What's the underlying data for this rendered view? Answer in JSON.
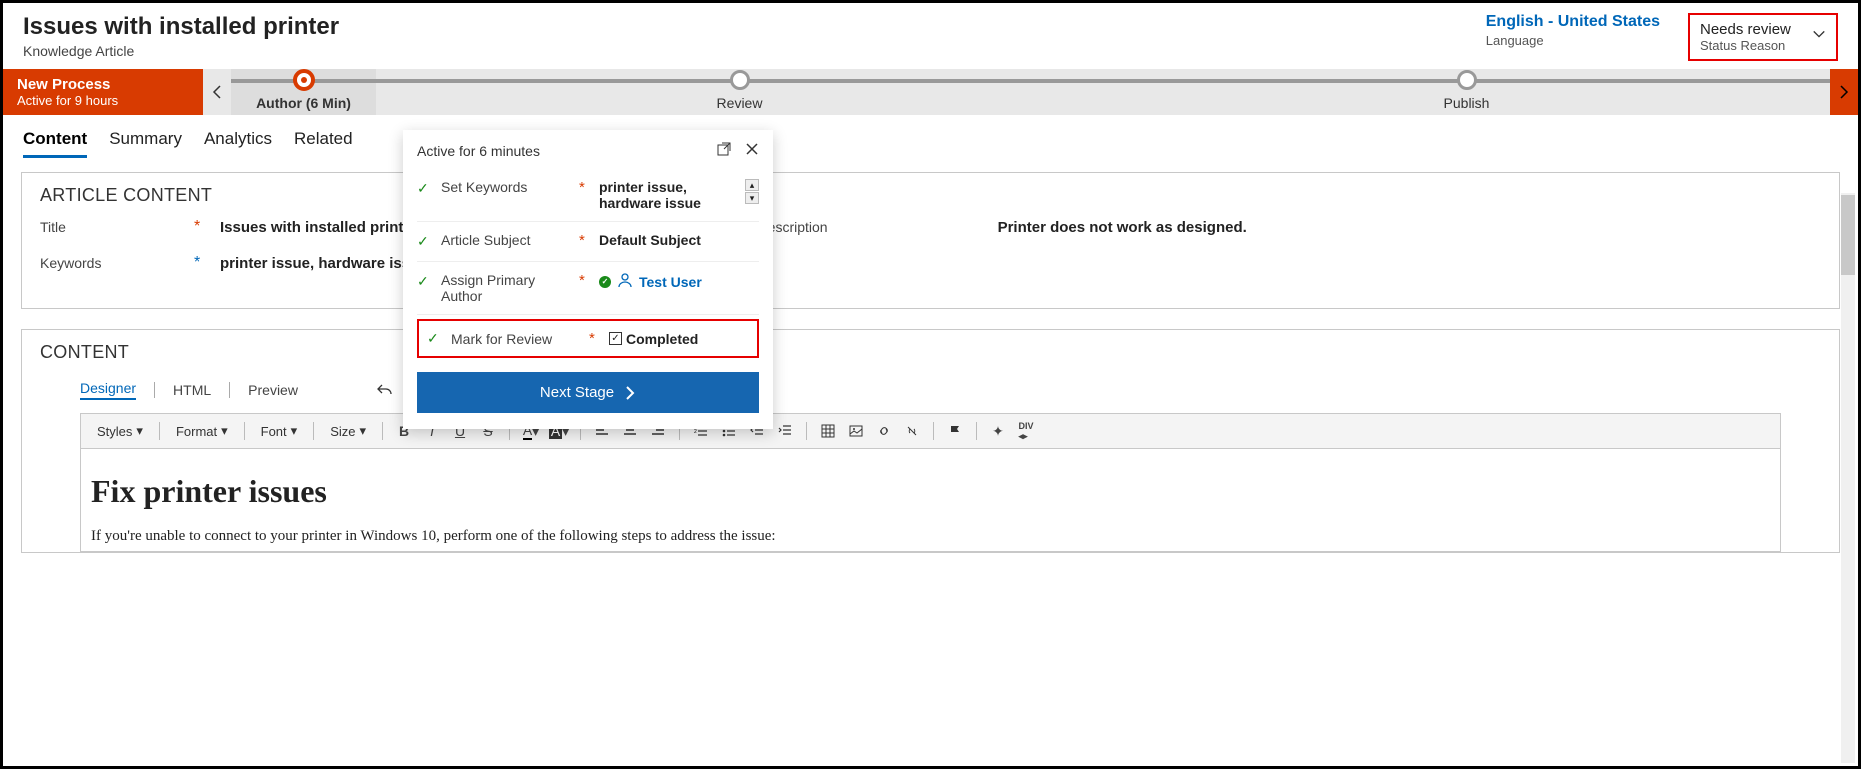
{
  "header": {
    "title": "Issues with installed printer",
    "subtitle": "Knowledge Article",
    "language": "English - United States",
    "language_label": "Language",
    "status": "Needs review",
    "status_label": "Status Reason"
  },
  "process": {
    "name": "New Process",
    "duration": "Active for 9 hours",
    "stages": {
      "author": "Author  (6 Min)",
      "review": "Review",
      "publish": "Publish"
    }
  },
  "tabs": {
    "content": "Content",
    "summary": "Summary",
    "analytics": "Analytics",
    "related": "Related"
  },
  "article": {
    "section_title": "ARTICLE CONTENT",
    "title_label": "Title",
    "title_value": "Issues with installed printer",
    "keywords_label": "Keywords",
    "keywords_value": "printer issue, hardware issue",
    "description_label": "Description",
    "description_value": "Printer does not work as designed."
  },
  "editor": {
    "section_title": "CONTENT",
    "tabs": {
      "designer": "Designer",
      "html": "HTML",
      "preview": "Preview"
    },
    "toolbar": {
      "styles": "Styles",
      "format": "Format",
      "font": "Font",
      "size": "Size"
    },
    "body_heading": "Fix printer issues",
    "body_text": "If you're unable to connect to your printer in Windows 10, perform one of the following steps to address the issue:"
  },
  "flyout": {
    "title": "Active for 6 minutes",
    "rows": {
      "set_keywords": {
        "label": "Set Keywords",
        "value": "printer issue, hardware issue"
      },
      "article_subject": {
        "label": "Article Subject",
        "value": "Default Subject"
      },
      "assign_author": {
        "label": "Assign Primary Author",
        "value": "Test User"
      },
      "mark_review": {
        "label": "Mark for Review",
        "value": "Completed"
      }
    },
    "next": "Next Stage"
  }
}
